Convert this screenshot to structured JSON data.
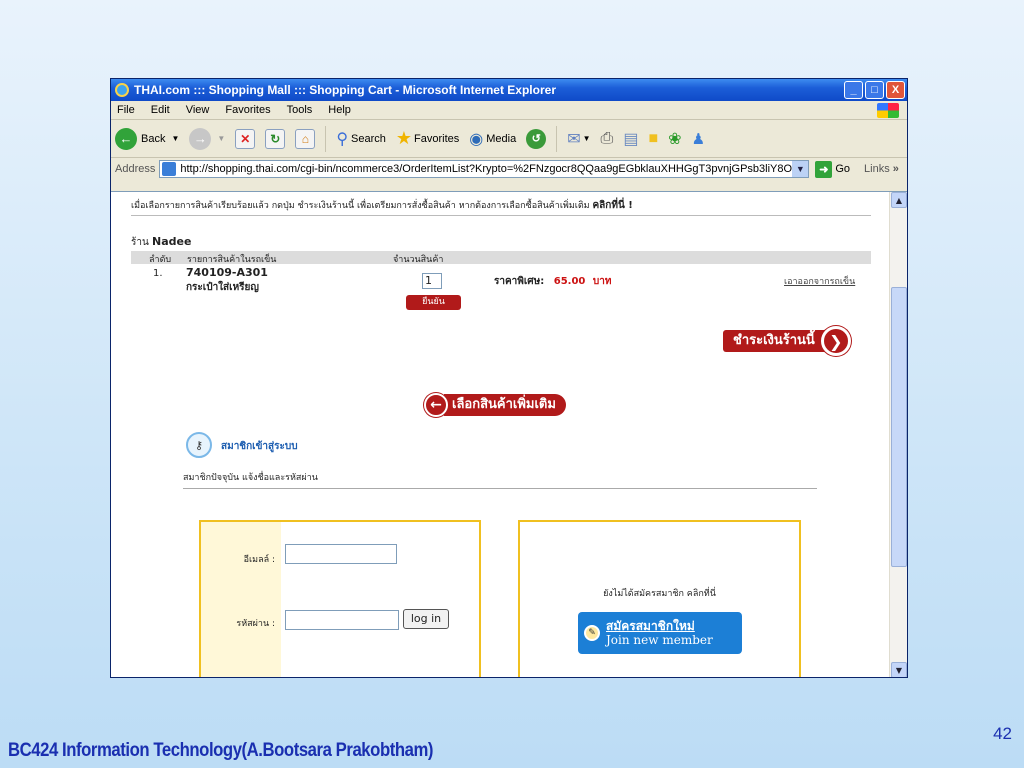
{
  "window": {
    "title": "THAI.com ::: Shopping Mall ::: Shopping Cart - Microsoft Internet Explorer",
    "controls": [
      "_",
      "□",
      "X"
    ]
  },
  "menu": [
    "File",
    "Edit",
    "View",
    "Favorites",
    "Tools",
    "Help"
  ],
  "toolbar": {
    "back": "Back",
    "search": "Search",
    "favorites": "Favorites",
    "media": "Media"
  },
  "address": {
    "label": "Address",
    "url": "http://shopping.thai.com/cgi-bin/ncommerce3/OrderItemList?Krypto=%2FNzgocr8QQaa9gEGbklauXHHGgT3pvnjGPsb3liY8OQ",
    "go": "Go",
    "links": "Links"
  },
  "page": {
    "notice": "เมื่อเลือกรายการสินค้าเรียบร้อยแล้ว กดปุ่ม ชำระเงินร้านนี้ เพื่อเตรียมการสั่งซื้อสินค้า หากต้องการเลือกซื้อสินค้าเพิ่มเติม",
    "notice_link": "คลิกที่นี่ !",
    "shop_prefix": "ร้าน",
    "shop_name": "Nadee",
    "cart_headers": [
      "ลำดับ",
      "รายการสินค้าในรถเข็น",
      "จำนวนสินค้า"
    ],
    "item": {
      "no": "1.",
      "code": "740109-A301",
      "name": "กระเป๋าใส่เหรียญ",
      "qty": "1",
      "confirm": "ยืนยัน",
      "price_label": "ราคาพิเศษ:",
      "price": "65.00",
      "unit": "บาท",
      "remove": "เอาออกจากรถเข็น"
    },
    "pay_button": "ชำระเงินร้านนี้",
    "more_button": "เลือกสินค้าเพิ่มเติม",
    "member_title": "สมาชิกเข้าสู่ระบบ",
    "member_sub": "สมาชิกปัจจุบัน แจ้งชื่อและรหัสผ่าน",
    "email_label": "อีเมลล์ :",
    "password_label": "รหัสผ่าน :",
    "login": "log in",
    "not_member": "ยังไม่ได้สมัครสมาชิก คลิกที่นี่",
    "join_th": "สมัครสมาชิกใหม่",
    "join_en": "Join new member"
  },
  "slide": {
    "footer": "BC424 Information Technology(A.Bootsara Prakobtham)",
    "page_number": "42"
  }
}
